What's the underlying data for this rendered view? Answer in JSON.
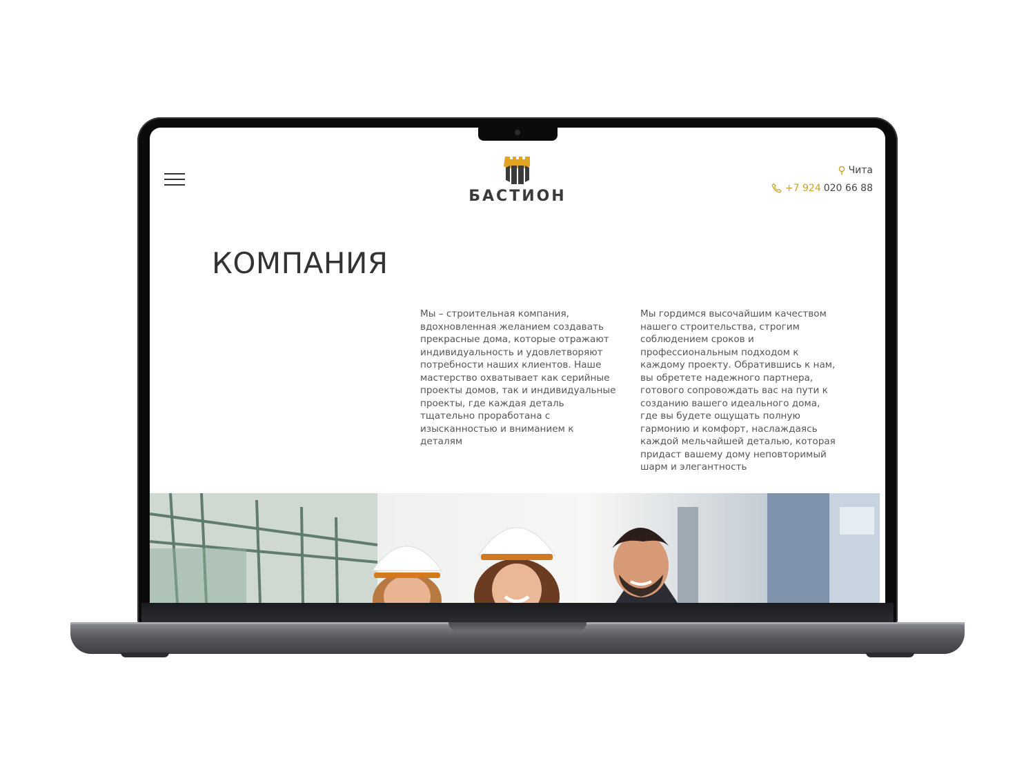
{
  "site": {
    "logo_text": "БАСТИОН",
    "city": "Чита",
    "phone_prefix": "+7 924",
    "phone_number": "020 66 88",
    "accent_color": "#c9a227"
  },
  "page": {
    "title": "КОМПАНИЯ",
    "paragraph_1": "Мы – строительная компания, вдохновленная желанием создавать прекрасные дома, которые отражают индивидуальность и удовлетворяют потребности наших клиентов. Наше мастерство охватывает как серийные проекты домов, так и индивидуальные проекты, где каждая деталь тщательно проработана с изысканностью и вниманием к деталям",
    "paragraph_2": "Мы гордимся высочайшим качеством нашего строительства, строгим соблюдением сроков и профессиональным подходом к каждому проекту. Обратившись к нам, вы обретете надежного партнера, готового сопровождать вас на пути к созданию вашего идеального дома, где вы будете ощущать полную гармонию и комфорт, наслаждаясь каждой мельчайшей деталью, которая придаст вашему дому неповторимый шарм и элегантность"
  },
  "icons": {
    "menu": "hamburger-icon",
    "location": "location-pin-icon",
    "phone": "phone-icon"
  }
}
